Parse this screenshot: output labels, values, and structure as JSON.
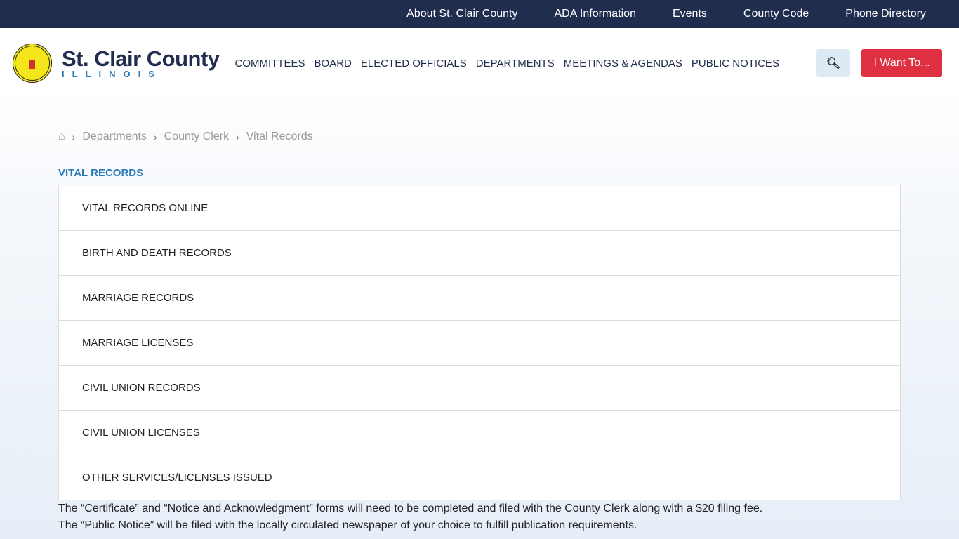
{
  "top_links": [
    "About St. Clair County",
    "ADA Information",
    "Events",
    "County Code",
    "Phone Directory"
  ],
  "logo": {
    "name": "St. Clair County",
    "state": "ILLINOIS"
  },
  "nav": [
    "COMMITTEES",
    "BOARD",
    "ELECTED OFFICIALS",
    "DEPARTMENTS",
    "MEETINGS & AGENDAS",
    "PUBLIC NOTICES"
  ],
  "search_icon": "search-icon",
  "want_label": "I Want To...",
  "breadcrumb": [
    "Departments",
    "County Clerk",
    "Vital Records"
  ],
  "section_title": "VITAL RECORDS",
  "items": [
    "VITAL RECORDS ONLINE",
    "BIRTH AND DEATH RECORDS",
    "MARRIAGE RECORDS",
    "MARRIAGE LICENSES",
    "CIVIL UNION RECORDS",
    "CIVIL UNION LICENSES",
    "OTHER SERVICES/LICENSES ISSUED"
  ],
  "body_text": [
    "The “Certificate” and “Notice and Acknowledgment” forms will need to be completed and filed with the County Clerk along with a $20 filing fee.",
    "The “Public Notice” will be filed with the locally circulated newspaper of your choice to fulfill publication requirements."
  ],
  "colors": {
    "navy": "#212d4f",
    "accent": "#2a7ab8",
    "red": "#de3040"
  }
}
